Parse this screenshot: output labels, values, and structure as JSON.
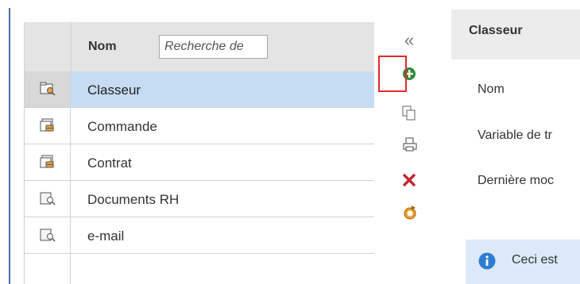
{
  "list": {
    "header_label": "Nom",
    "search_placeholder": "Recherche de",
    "rows": [
      {
        "label": "Classeur",
        "icon": "folder-search-icon",
        "selected": true
      },
      {
        "label": "Commande",
        "icon": "document-stack-icon"
      },
      {
        "label": "Contrat",
        "icon": "document-stack-icon"
      },
      {
        "label": "Documents RH",
        "icon": "document-search-icon"
      },
      {
        "label": "e-mail",
        "icon": "document-search-icon"
      }
    ]
  },
  "toolbar": {
    "collapse": "«",
    "actions": [
      "add-icon",
      "copy-icon",
      "print-icon",
      "delete-icon",
      "reset-icon"
    ]
  },
  "details": {
    "title": "Classeur",
    "field_name": "Nom",
    "field_variable": "Variable de tr",
    "field_modified": "Dernière moc",
    "info": "Ceci est"
  },
  "colors": {
    "selected_row": "#c5dcf2",
    "header": "#e4e4e4",
    "add_green": "#2e8b3a",
    "delete_red": "#c0282e",
    "highlight": "#e2292f",
    "info_blue": "#2f7dd1"
  }
}
